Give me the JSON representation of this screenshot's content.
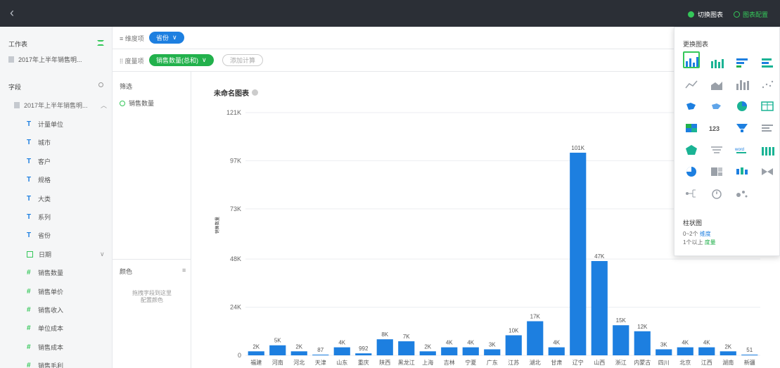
{
  "topbar": {
    "back_label": "‹",
    "switch_chart_label": "切换图表",
    "chart_config_label": "图表配置"
  },
  "sidebar": {
    "worksheet_title": "工作表",
    "worksheet_name": "2017年上半年销售明...",
    "fields_title": "字段",
    "tree_root": "2017年上半年销售明...",
    "fields": [
      {
        "type": "T",
        "name": "计量单位"
      },
      {
        "type": "T",
        "name": "城市"
      },
      {
        "type": "T",
        "name": "客户"
      },
      {
        "type": "T",
        "name": "规格"
      },
      {
        "type": "T",
        "name": "大类"
      },
      {
        "type": "T",
        "name": "系列"
      },
      {
        "type": "T",
        "name": "省份"
      },
      {
        "type": "date",
        "name": "日期"
      },
      {
        "type": "#",
        "name": "销售数量"
      },
      {
        "type": "#",
        "name": "销售单价"
      },
      {
        "type": "#",
        "name": "销售收入"
      },
      {
        "type": "#",
        "name": "单位成本"
      },
      {
        "type": "#",
        "name": "销售成本"
      },
      {
        "type": "#",
        "name": "销售毛利"
      }
    ]
  },
  "shelves": {
    "dimension_label": "维度项",
    "dimension_pill": "省份",
    "measure_label": "度量项",
    "measure_pill": "销售数量(总和)",
    "add_calc": "添加计算"
  },
  "config": {
    "filter_title": "筛选",
    "filter_item": "销售数量",
    "color_title": "颜色",
    "color_hint_1": "拖拽字段到这里",
    "color_hint_2": "配置颜色"
  },
  "popover": {
    "title": "更换图表",
    "selected_name": "柱状图",
    "req_dims_prefix": "0~2个",
    "req_dims": "维度",
    "req_meas_prefix": "1个以上",
    "req_meas": "度量",
    "icons": [
      "bar-chart",
      "stacked-bar",
      "horizontal-bar",
      "stacked-horizontal-bar",
      "line-chart",
      "area-chart",
      "column-group",
      "scatter-small",
      "map",
      "flow-map",
      "pie-chart",
      "table",
      "heatmap",
      "kpi",
      "funnel",
      "bar-list",
      "radar",
      "filter-list",
      "word-cloud",
      "matrix",
      "donut",
      "treemap",
      "box-plot",
      "sankey",
      "tree",
      "gauge",
      "bubble"
    ],
    "kpi_text": "123",
    "wordcloud_text": "word"
  },
  "colors": {
    "bar": "#1d7fe0",
    "accent_green": "#22b14c"
  },
  "chart_data": {
    "type": "bar",
    "title": "未命名图表",
    "ylabel": "销售数量",
    "ylim": [
      0,
      121000
    ],
    "y_ticks": [
      "0",
      "24K",
      "48K",
      "73K",
      "97K",
      "121K"
    ],
    "y_tick_values": [
      0,
      24000,
      48000,
      73000,
      97000,
      121000
    ],
    "categories": [
      "福建",
      "河南",
      "河北",
      "天津",
      "山东",
      "重庆",
      "陕西",
      "黑龙江",
      "上海",
      "吉林",
      "宁夏",
      "广东",
      "江苏",
      "湖北",
      "甘肃",
      "辽宁",
      "山西",
      "浙江",
      "内蒙古",
      "四川",
      "北京",
      "江西",
      "湖南",
      "新疆"
    ],
    "values": [
      2000,
      5000,
      2000,
      87,
      4000,
      992,
      8000,
      7000,
      2000,
      4000,
      4000,
      3000,
      10000,
      17000,
      4000,
      101000,
      47000,
      15000,
      12000,
      3000,
      4000,
      4000,
      2000,
      51
    ],
    "data_labels": [
      "2K",
      "5K",
      "2K",
      "87",
      "4K",
      "992",
      "8K",
      "7K",
      "2K",
      "4K",
      "4K",
      "3K",
      "10K",
      "17K",
      "4K",
      "101K",
      "47K",
      "15K",
      "12K",
      "3K",
      "4K",
      "4K",
      "2K",
      "51"
    ]
  }
}
